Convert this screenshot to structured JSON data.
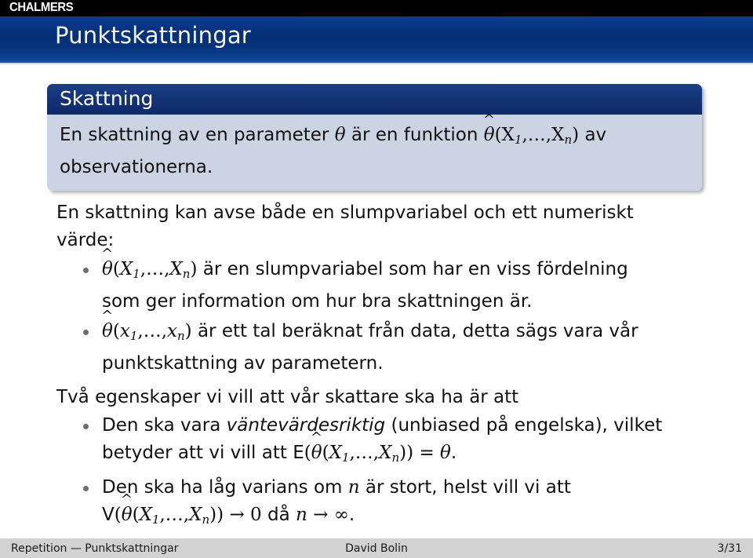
{
  "brand": {
    "logo_text": "CHALMERS",
    "logo_bar_color": "#000000",
    "title_bar_color": "#093b8f",
    "block_title_color": "#13316f",
    "block_body_color": "#ccd4e4",
    "footer_color": "#d2d2d2"
  },
  "slide": {
    "title": "Punktskattningar"
  },
  "block": {
    "title": "Skattning",
    "body_line1_a": "En skattning av en parameter ",
    "body_theta": "θ",
    "body_line1_b": " är en funktion ",
    "body_theta_hat": "θ",
    "body_args_X": "(X",
    "body_sub1": "1",
    "body_dots": ",…,X",
    "body_subn": "n",
    "body_close": ")",
    "body_line1_c": " av",
    "body_line2": "observationerna."
  },
  "body": {
    "paragraph1_line1": "En skattning kan avse både en slumpvariabel och ett numeriskt",
    "paragraph1_line2": "värde:",
    "paragraph2": "Två egenskaper vi vill att vår skattare ska ha är att"
  },
  "bullets_group1": [
    {
      "math_prefix": "θ̂(X₁,…,Xₙ)",
      "text_line1": " är en slumpvariabel som har en viss fördelning",
      "text_line2": "som ger information om hur bra skattningen är.",
      "var_case": "upper"
    },
    {
      "math_prefix": "θ̂(x₁,…,xₙ)",
      "text_line1": " är ett tal beräknat från data, detta sägs vara vår",
      "text_line2": "punktskattning av parametern.",
      "var_case": "lower"
    }
  ],
  "bullets_group2": [
    {
      "text_a": "Den ska vara ",
      "emphasis": "väntevärdesriktig",
      "text_b": " (unbiased på engelska), vilket",
      "text_line2_a": "betyder att vi vill att ",
      "math": "E(θ̂(X₁,…,Xₙ)) = θ",
      "text_line2_b": "."
    },
    {
      "text_a": "Den ska ha låg varians om ",
      "var_n": "n",
      "text_b": " är stort, helst vill vi att",
      "math": "V(θ̂(X₁,…,Xₙ)) → 0 då n → ∞",
      "text_line2_b": "."
    }
  ],
  "footer": {
    "left": "Repetition — Punktskattningar",
    "center": "David Bolin",
    "right": "3/31"
  },
  "symbols": {
    "theta": "θ",
    "hat": "^",
    "ellipsis": "…",
    "arrow": "→",
    "infinity": "∞",
    "equals": "=",
    "X": "X",
    "x": "x",
    "n": "n",
    "one": "1",
    "E": "E",
    "V": "V",
    "zero": "0",
    "lparen": "(",
    "rparen": ")",
    "comma": ",",
    "period": "."
  }
}
